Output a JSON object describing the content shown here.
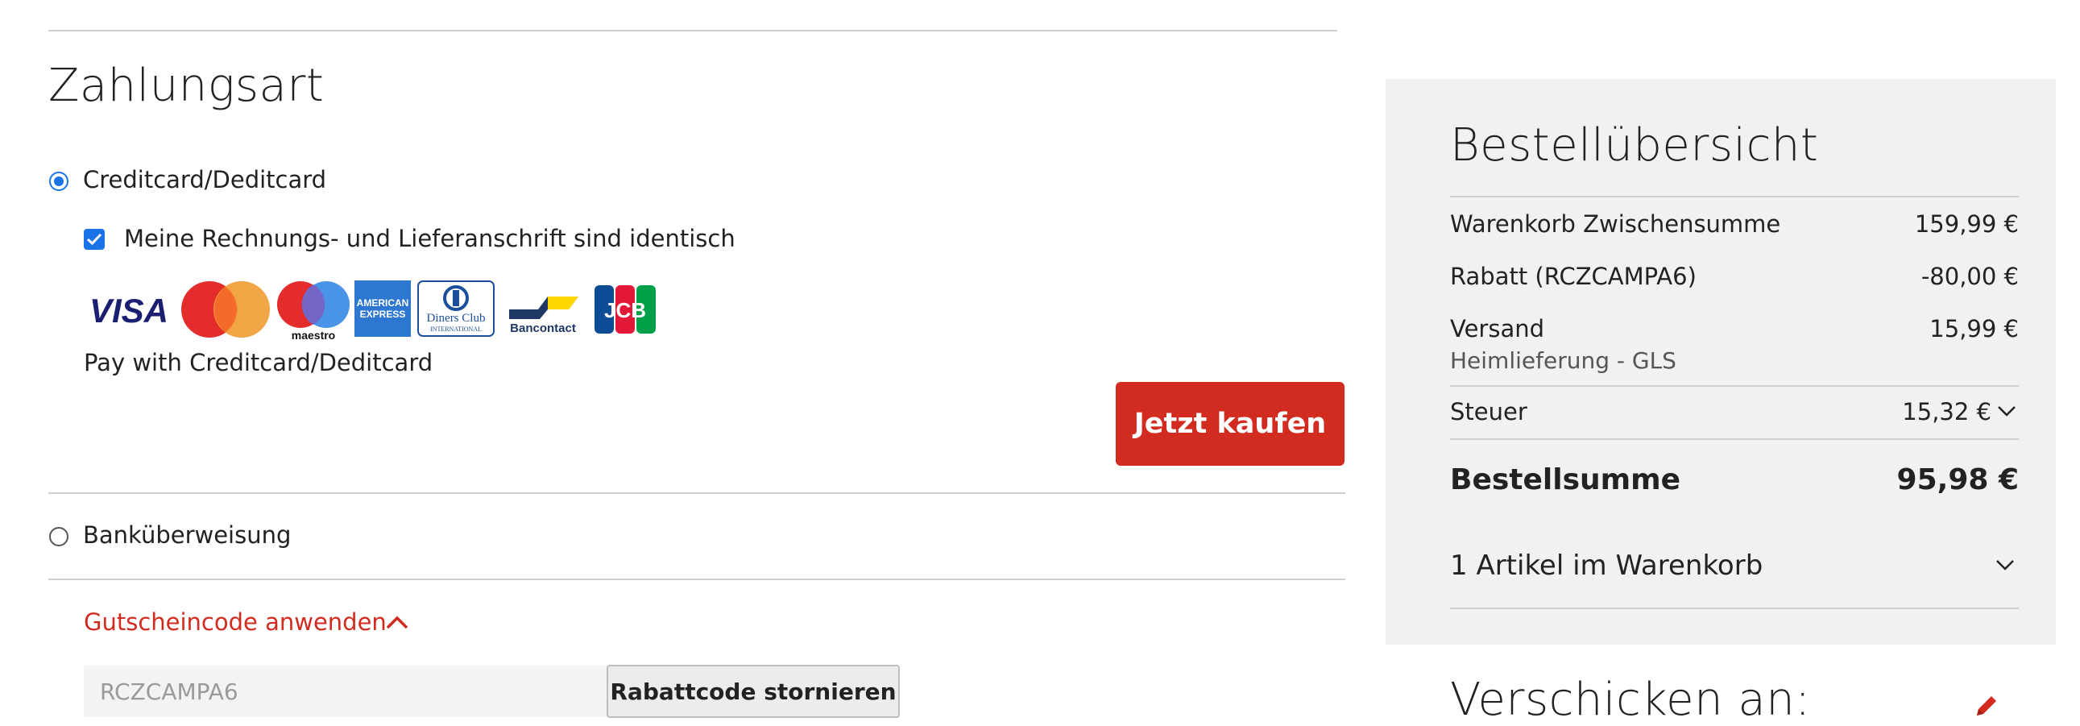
{
  "payment": {
    "title": "Zahlungsart",
    "option_card": "Creditcard/Deditcard",
    "billing_same": "Meine Rechnungs- und Lieferanschrift sind identisch",
    "pay_with": "Pay with Creditcard/Deditcard",
    "buy_button": "Jetzt kaufen",
    "option_bank": "Banküberweisung",
    "cards": {
      "visa": "VISA",
      "maestro": "maestro",
      "amex_top": "AMERICAN",
      "amex_bottom": "EXPRESS",
      "diners": "Diners Club",
      "diners_sub": "INTERNATIONAL",
      "bancontact": "Bancontact",
      "jcb": "JCB"
    }
  },
  "coupon": {
    "toggle_label": "Gutscheincode anwenden",
    "code_value": "RCZCAMPA6",
    "cancel_button": "Rabattcode stornieren"
  },
  "summary": {
    "title": "Bestellübersicht",
    "subtotal_label": "Warenkorb Zwischensumme",
    "subtotal_value": "159,99 €",
    "discount_label": "Rabatt (RCZCAMPA6)",
    "discount_value": "-80,00 €",
    "shipping_label": "Versand",
    "shipping_value": "15,99 €",
    "shipping_method": "Heimlieferung - GLS",
    "tax_label": "Steuer",
    "tax_value": "15,32 €",
    "total_label": "Bestellsumme",
    "total_value": "95,98 €",
    "cart_items": "1 Artikel im Warenkorb"
  },
  "shipping": {
    "title": "Verschicken an:"
  },
  "colors": {
    "accent_red": "#d22b1f",
    "radio_blue": "#1a73e8",
    "panel_bg": "#f1f1f1"
  }
}
